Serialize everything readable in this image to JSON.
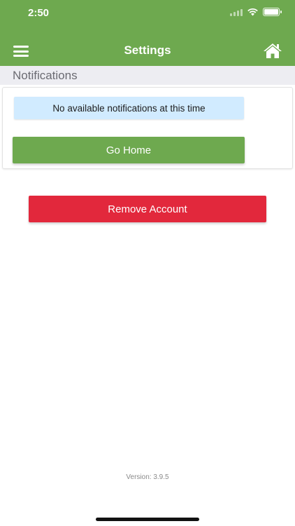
{
  "status_bar": {
    "time": "2:50",
    "icons": [
      "signal-icon",
      "wifi-icon",
      "battery-icon"
    ]
  },
  "header": {
    "title": "Settings",
    "menu_icon": "hamburger-menu-icon",
    "home_icon": "home-icon",
    "background_color": "#6ea94f"
  },
  "notifications": {
    "section_label": "Notifications",
    "empty_message": "No available notifications at this time",
    "go_home_label": "Go Home"
  },
  "account": {
    "remove_label": "Remove Account",
    "remove_color": "#e2283c"
  },
  "footer": {
    "version": "Version: 3.9.5"
  }
}
